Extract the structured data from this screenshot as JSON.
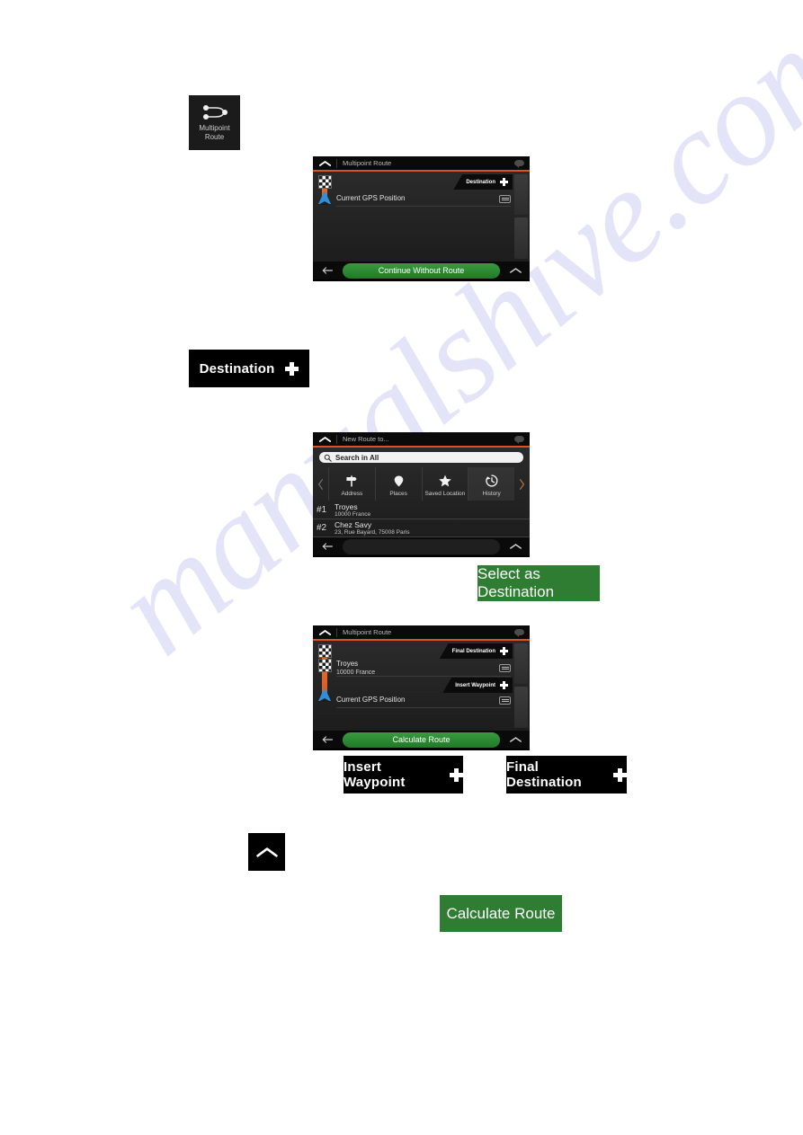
{
  "watermark": {
    "text": "manualshive.com"
  },
  "multipoint_tile": {
    "icon": "multipoint-route-icon",
    "label_line1": "Multipoint",
    "label_line2": "Route"
  },
  "buttons": {
    "destination": {
      "label": "Destination",
      "icon": "plus-icon"
    },
    "select_as_destination": {
      "label": "Select as Destination"
    },
    "insert_waypoint": {
      "label": "Insert Waypoint",
      "icon": "plus-icon"
    },
    "final_destination": {
      "label": "Final Destination",
      "icon": "plus-icon"
    },
    "up_arrow": {
      "icon": "chevron-up-icon"
    },
    "calculate_route": {
      "label": "Calculate Route"
    }
  },
  "device1": {
    "header": {
      "title": "Multipoint Route",
      "up_icon": "chevron-up-icon",
      "bubble_icon": "speech-bubble-icon"
    },
    "destination_tab": {
      "label": "Destination",
      "icon": "plus-icon"
    },
    "gps_row": {
      "title": "Current GPS Position",
      "menu_icon": "list-menu-icon"
    },
    "footer": {
      "back_icon": "arrow-left-icon",
      "main_label": "Continue Without Route",
      "up_icon": "chevron-up-icon"
    }
  },
  "device2": {
    "header": {
      "title": "New Route to...",
      "up_icon": "chevron-up-icon",
      "bubble_icon": "speech-bubble-icon"
    },
    "search": {
      "value": "Search in All",
      "icon": "search-icon"
    },
    "categories": [
      {
        "label": "Address",
        "icon": "signpost-icon",
        "active": false
      },
      {
        "label": "Places",
        "icon": "map-pin-icon",
        "active": false
      },
      {
        "label": "Saved Location",
        "icon": "star-icon",
        "active": false
      },
      {
        "label": "History",
        "icon": "history-clock-icon",
        "active": true
      }
    ],
    "nav_prev_icon": "chevron-left-icon",
    "nav_next_icon": "chevron-right-icon",
    "history": [
      {
        "index": "#1",
        "title": "Troyes",
        "subtitle": "10000 France"
      },
      {
        "index": "#2",
        "title": "Chez Savy",
        "subtitle": "23, Rue Bayard, 75008 Paris"
      }
    ],
    "footer": {
      "back_icon": "arrow-left-icon",
      "up_icon": "chevron-up-icon"
    }
  },
  "device3": {
    "header": {
      "title": "Multipoint Route",
      "up_icon": "chevron-up-icon",
      "bubble_icon": "speech-bubble-icon"
    },
    "final_destination_tab": {
      "label": "Final Destination",
      "icon": "plus-icon"
    },
    "waypoint_row": {
      "title": "Troyes",
      "subtitle": "10000 France",
      "menu_icon": "list-menu-icon"
    },
    "insert_waypoint_tab": {
      "label": "Insert Waypoint",
      "icon": "plus-icon"
    },
    "gps_row": {
      "title": "Current GPS Position",
      "menu_icon": "list-menu-icon"
    },
    "footer": {
      "back_icon": "arrow-left-icon",
      "main_label": "Calculate Route",
      "up_icon": "chevron-up-icon"
    }
  },
  "colors": {
    "accent_orange": "#d9541e",
    "green_button": "#2e7d32",
    "green_footer": "#2f8a35",
    "black_button": "#000000",
    "device_bg": "#232323"
  }
}
